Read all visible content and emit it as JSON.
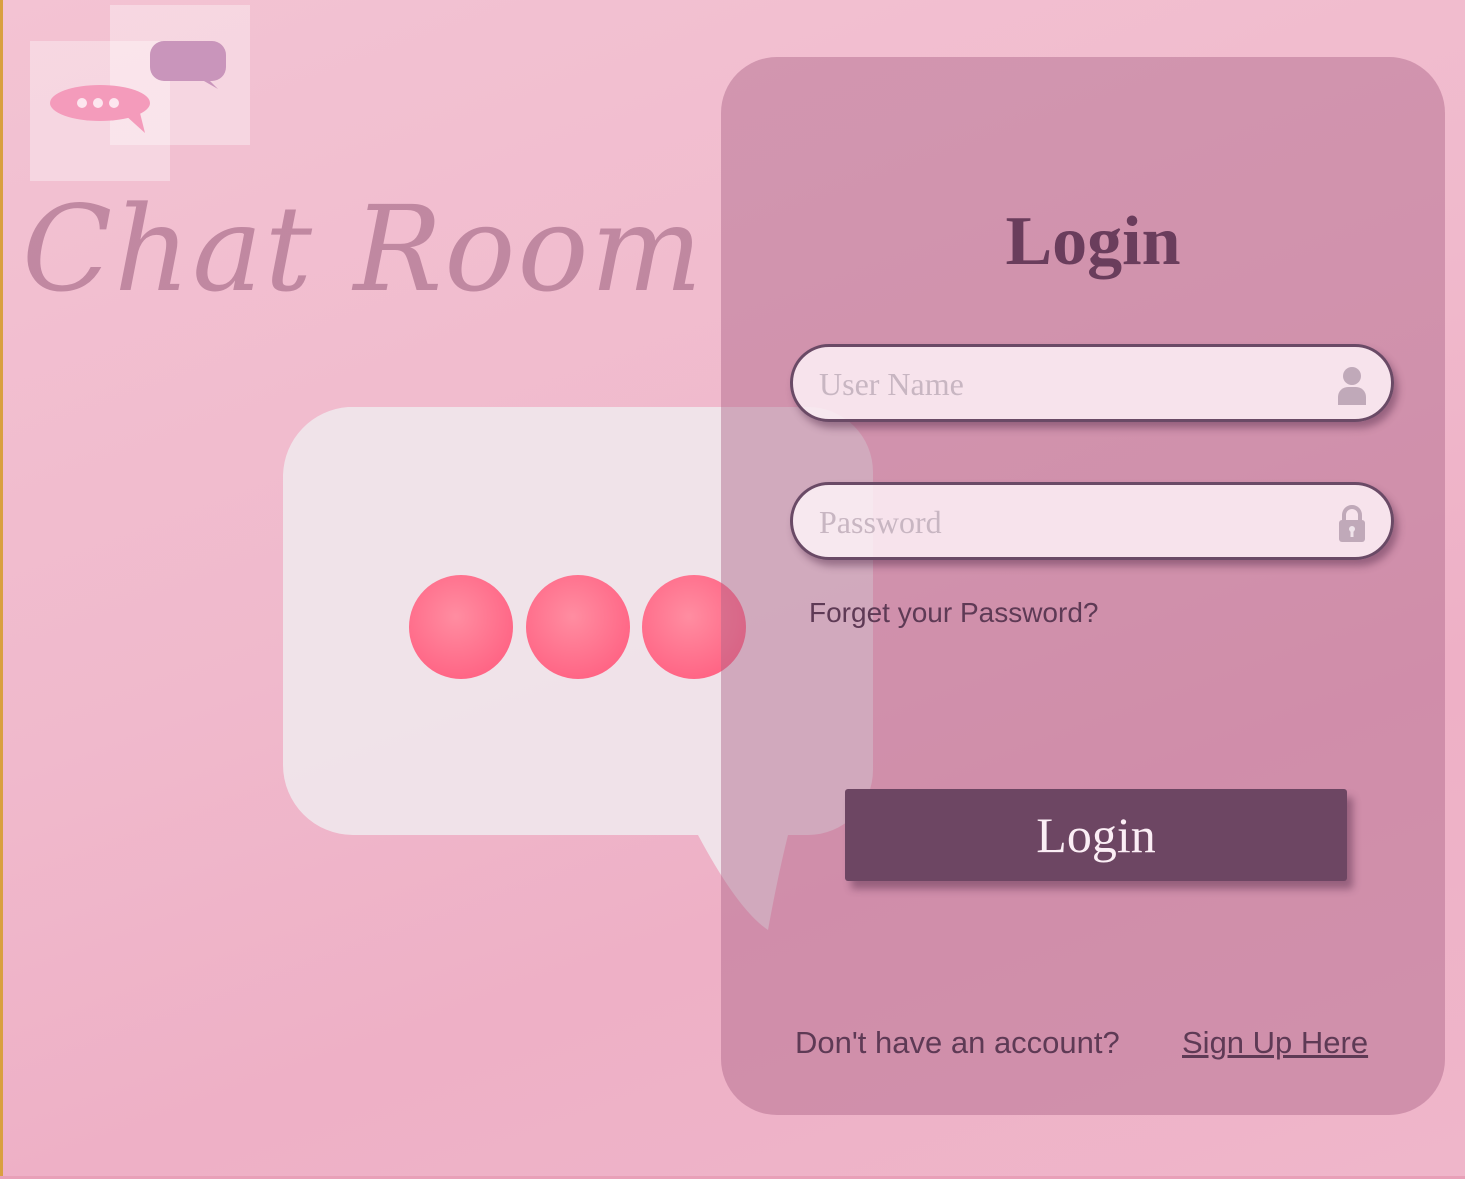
{
  "app": {
    "title": "Chat Room"
  },
  "login": {
    "heading": "Login",
    "username_placeholder": "User Name",
    "password_placeholder": "Password",
    "forgot_label": "Forget your Password?",
    "submit_label": "Login",
    "no_account_text": "Don't have an account?",
    "signup_label": "Sign Up Here"
  },
  "icons": {
    "logo": "chat-bubbles-icon",
    "username": "user-icon",
    "password": "lock-icon",
    "background": "chat-bubble-typing-icon"
  },
  "colors": {
    "panel": "#aa6487",
    "accent": "#6d4663",
    "text": "#5e3a55",
    "bubble_dot": "#ff6f8a"
  }
}
